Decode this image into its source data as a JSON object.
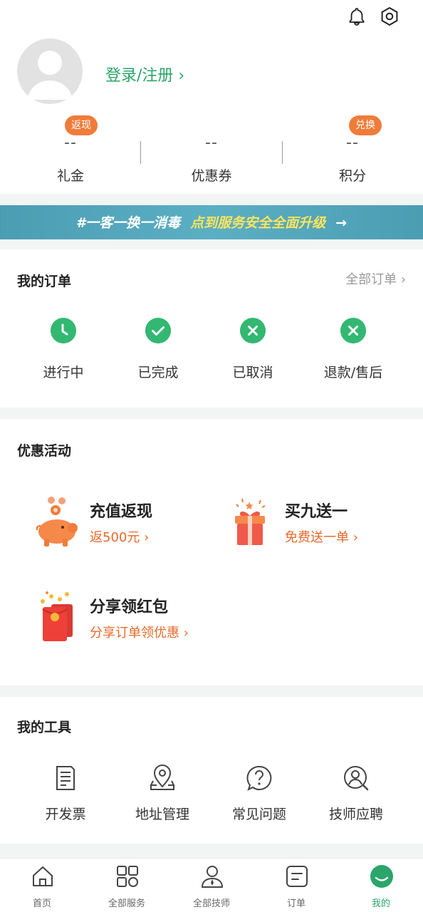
{
  "header": {
    "icons": [
      "bell-icon",
      "settings-icon"
    ]
  },
  "profile": {
    "login_label": "登录/注册 ›"
  },
  "stats": [
    {
      "badge": "返现",
      "value": "--",
      "label": "礼金"
    },
    {
      "badge": "",
      "value": "--",
      "label": "优惠券"
    },
    {
      "badge": "兑换",
      "value": "--",
      "label": "积分"
    }
  ],
  "banner": {
    "text": "#一客一换一消毒",
    "highlight": "点到服务安全全面升级",
    "arrow": "→"
  },
  "orders": {
    "title": "我的订单",
    "all_label": "全部订单 ›",
    "items": [
      {
        "label": "进行中",
        "icon": "clock-icon"
      },
      {
        "label": "已完成",
        "icon": "check-icon"
      },
      {
        "label": "已取消",
        "icon": "cancel-icon"
      },
      {
        "label": "退款/售后",
        "icon": "refund-icon"
      }
    ]
  },
  "promos": {
    "title": "优惠活动",
    "items": [
      {
        "title": "充值返现",
        "subtitle": "返500元 ›",
        "icon": "piggy-bank-icon"
      },
      {
        "title": "买九送一",
        "subtitle": "免费送一单 ›",
        "icon": "gift-icon"
      },
      {
        "title": "分享领红包",
        "subtitle": "分享订单领优惠 ›",
        "icon": "red-envelope-icon"
      }
    ]
  },
  "tools": {
    "title": "我的工具",
    "items": [
      {
        "label": "开发票",
        "icon": "invoice-icon"
      },
      {
        "label": "地址管理",
        "icon": "location-icon"
      },
      {
        "label": "常见问题",
        "icon": "question-icon"
      },
      {
        "label": "技师应聘",
        "icon": "recruit-icon"
      }
    ]
  },
  "tabbar": {
    "active": 4,
    "items": [
      {
        "label": "首页",
        "icon": "home-icon"
      },
      {
        "label": "全部服务",
        "icon": "grid-icon"
      },
      {
        "label": "全部技师",
        "icon": "technician-icon"
      },
      {
        "label": "订单",
        "icon": "orders-icon"
      },
      {
        "label": "我的",
        "icon": "profile-icon"
      }
    ]
  },
  "colors": {
    "accent": "#2ba56a",
    "order_icon": "#33b872",
    "promo_text": "#e8692a",
    "badge": "#f07c3a",
    "banner": "#4b9db2"
  }
}
